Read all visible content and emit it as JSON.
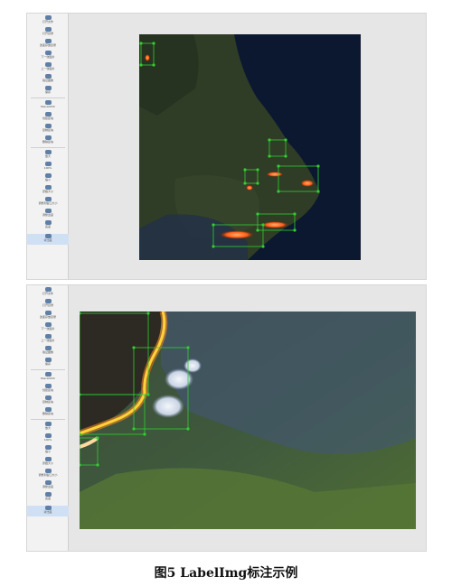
{
  "caption": "图5 LabelImg标注示例",
  "toolbar_top": [
    {
      "label": "打开文件",
      "icon": "open-icon"
    },
    {
      "label": "打开目录",
      "icon": "folder-icon"
    },
    {
      "label": "改变存放目录",
      "icon": "change-dir-icon"
    },
    {
      "label": "下一张图片",
      "icon": "next-icon"
    },
    {
      "label": "上一张图片",
      "icon": "prev-icon"
    },
    {
      "label": "验证图像",
      "icon": "verify-icon"
    },
    {
      "label": "保存",
      "icon": "save-icon"
    },
    {
      "label": "PascalVOC",
      "icon": "format-icon"
    },
    {
      "label": "创建区块",
      "icon": "create-box-icon"
    },
    {
      "label": "复制区块",
      "icon": "duplicate-icon"
    },
    {
      "label": "删除区块",
      "icon": "delete-icon"
    },
    {
      "label": "放大",
      "icon": "zoom-in-icon"
    },
    {
      "label": "100%",
      "icon": "zoom-level-icon"
    },
    {
      "label": "缩小",
      "icon": "zoom-out-icon"
    },
    {
      "label": "原始大小",
      "icon": "fit-window-icon"
    },
    {
      "label": "调整到窗口大小",
      "icon": "fit-width-icon"
    },
    {
      "label": "调整宽度",
      "icon": "adjust-width-icon"
    },
    {
      "label": "亮度",
      "icon": "brightness-icon"
    },
    {
      "label": "对比度",
      "icon": "contrast-icon"
    }
  ],
  "toolbar_bottom": [
    {
      "label": "打开文件",
      "icon": "open-icon"
    },
    {
      "label": "打开目录",
      "icon": "folder-icon"
    },
    {
      "label": "改变存放目录",
      "icon": "change-dir-icon"
    },
    {
      "label": "下一张图片",
      "icon": "next-icon"
    },
    {
      "label": "上一张图片",
      "icon": "prev-icon"
    },
    {
      "label": "验证图像",
      "icon": "verify-icon"
    },
    {
      "label": "保存",
      "icon": "save-icon"
    },
    {
      "label": "PascalVOC",
      "icon": "format-icon"
    },
    {
      "label": "创建区块",
      "icon": "create-box-icon"
    },
    {
      "label": "复制区块",
      "icon": "duplicate-icon"
    },
    {
      "label": "删除区块",
      "icon": "delete-icon"
    },
    {
      "label": "放大",
      "icon": "zoom-in-icon"
    },
    {
      "label": "100%",
      "icon": "zoom-level-icon"
    },
    {
      "label": "缩小",
      "icon": "zoom-out-icon"
    },
    {
      "label": "原始大小",
      "icon": "fit-window-icon"
    },
    {
      "label": "调整到窗口大小",
      "icon": "fit-width-icon"
    },
    {
      "label": "调整宽度",
      "icon": "adjust-width-icon"
    },
    {
      "label": "亮度",
      "icon": "brightness-icon"
    },
    {
      "label": "对比度",
      "icon": "contrast-icon"
    }
  ],
  "colors": {
    "box": "#33cc33",
    "fire": "#ff5a14",
    "land": "#2d3a24",
    "sea": "#0c1830",
    "smoke": "#dfe6f0"
  }
}
